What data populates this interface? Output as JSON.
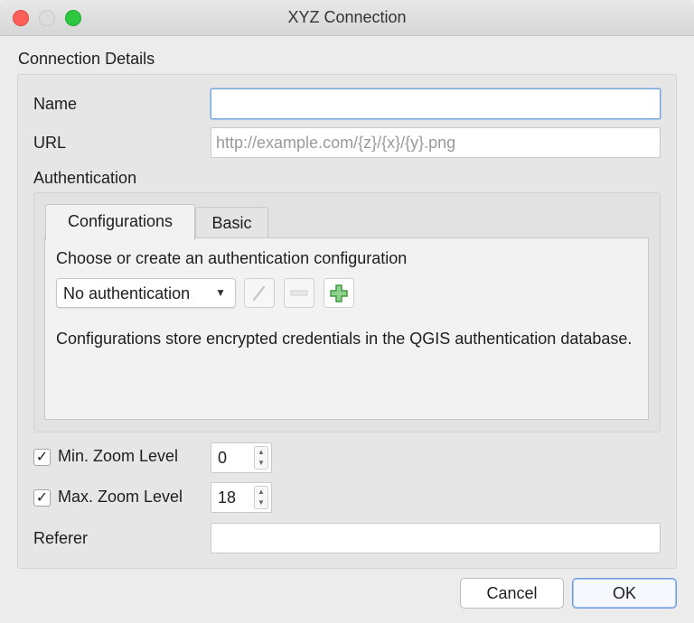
{
  "window": {
    "title": "XYZ Connection"
  },
  "connection_details": {
    "heading": "Connection Details",
    "name_label": "Name",
    "name_value": "",
    "url_label": "URL",
    "url_placeholder": "http://example.com/{z}/{x}/{y}.png",
    "url_value": "",
    "authentication_label": "Authentication"
  },
  "auth": {
    "tabs": [
      {
        "label": "Configurations",
        "active": true
      },
      {
        "label": "Basic",
        "active": false
      }
    ],
    "choose_text": "Choose or create an authentication configuration",
    "select_value": "No authentication",
    "info_text": "Configurations store encrypted credentials in the QGIS authentication database.",
    "icons": [
      "edit-pencil-icon",
      "remove-minus-icon",
      "add-plus-icon"
    ]
  },
  "zoom": {
    "min_label": "Min. Zoom Level",
    "min_checked": true,
    "min_value": "0",
    "max_label": "Max. Zoom Level",
    "max_checked": true,
    "max_value": "18"
  },
  "referer": {
    "label": "Referer",
    "value": ""
  },
  "buttons": {
    "cancel": "Cancel",
    "ok": "OK"
  },
  "colors": {
    "close": "#fc5f57",
    "maximize": "#2bc840",
    "focus_ring": "#7da6d8",
    "add_icon_green": "#3f9b3f"
  }
}
